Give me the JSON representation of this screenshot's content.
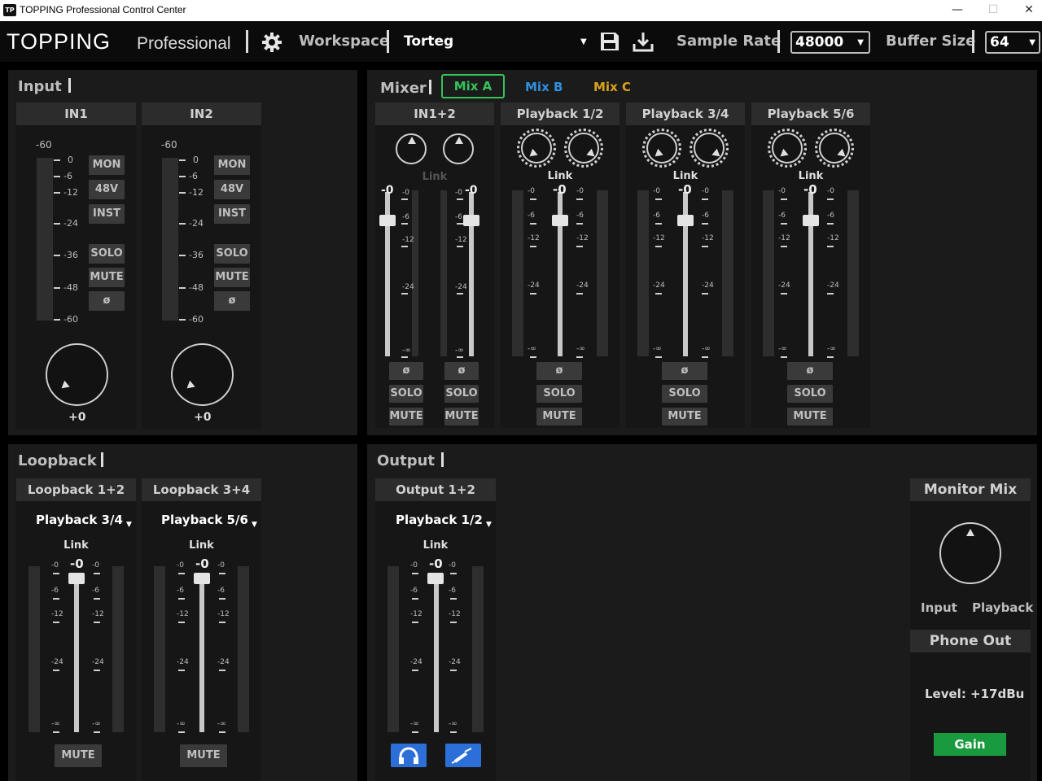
{
  "window": {
    "title": "TOPPING Professional Control Center",
    "logo": "TP",
    "minimize": "—",
    "maximize": "☐",
    "close": "✕"
  },
  "header": {
    "brand": "TOPPING",
    "brand_sub": "Professional",
    "settings_icon": "gear-icon",
    "workspace_label": "Workspace",
    "workspace_value": "Torteg",
    "save_icon": "save-icon",
    "download_icon": "download-icon",
    "sample_rate_label": "Sample Rate",
    "sample_rate_value": "48000",
    "buffer_size_label": "Buffer Size",
    "buffer_size_value": "64"
  },
  "input": {
    "title": "Input",
    "channels": [
      {
        "name": "IN1",
        "top_db": "-60",
        "scale": [
          "0",
          "-6",
          "-12",
          "-24",
          "-36",
          "-48",
          "-60"
        ],
        "buttons": [
          "MON",
          "48V",
          "INST",
          "SOLO",
          "MUTE",
          "ø"
        ],
        "gain": "+0"
      },
      {
        "name": "IN2",
        "top_db": "-60",
        "scale": [
          "0",
          "-6",
          "-12",
          "-24",
          "-36",
          "-48",
          "-60"
        ],
        "buttons": [
          "MON",
          "48V",
          "INST",
          "SOLO",
          "MUTE",
          "ø"
        ],
        "gain": "+0"
      }
    ]
  },
  "mixer": {
    "title": "Mixer",
    "tabs": [
      {
        "label": "Mix A",
        "color": "#35c35a"
      },
      {
        "label": "Mix B",
        "color": "#2f8fe0"
      },
      {
        "label": "Mix C",
        "color": "#d8a21d"
      }
    ],
    "link_label": "Link",
    "fader_value": "-0",
    "scale": [
      "-0",
      "-6",
      "-12",
      "-24",
      "-∞"
    ],
    "phase": "ø",
    "solo": "SOLO",
    "mute": "MUTE",
    "channels": [
      {
        "name": "IN1+2",
        "link_disabled": "Link"
      },
      {
        "name": "Playback 1/2"
      },
      {
        "name": "Playback 3/4"
      },
      {
        "name": "Playback 5/6"
      }
    ]
  },
  "loopback": {
    "title": "Loopback",
    "channels": [
      {
        "name": "Loopback 1+2",
        "source": "Playback 3/4"
      },
      {
        "name": "Loopback 3+4",
        "source": "Playback 5/6"
      }
    ],
    "link_label": "Link",
    "fader_value": "-0",
    "mute": "MUTE"
  },
  "output": {
    "title": "Output",
    "channel": {
      "name": "Output 1+2",
      "source": "Playback 1/2",
      "link_label": "Link",
      "fader_value": "-0"
    },
    "headphone_icon": "headphone-icon",
    "line_icon": "line-out-icon"
  },
  "monitor": {
    "title": "Monitor Mix",
    "left_label": "Input",
    "right_label": "Playback",
    "phone_out": "Phone Out",
    "level": "Level: +17dBu",
    "gain_button": "Gain",
    "gain_color": "#1a9a3e"
  }
}
